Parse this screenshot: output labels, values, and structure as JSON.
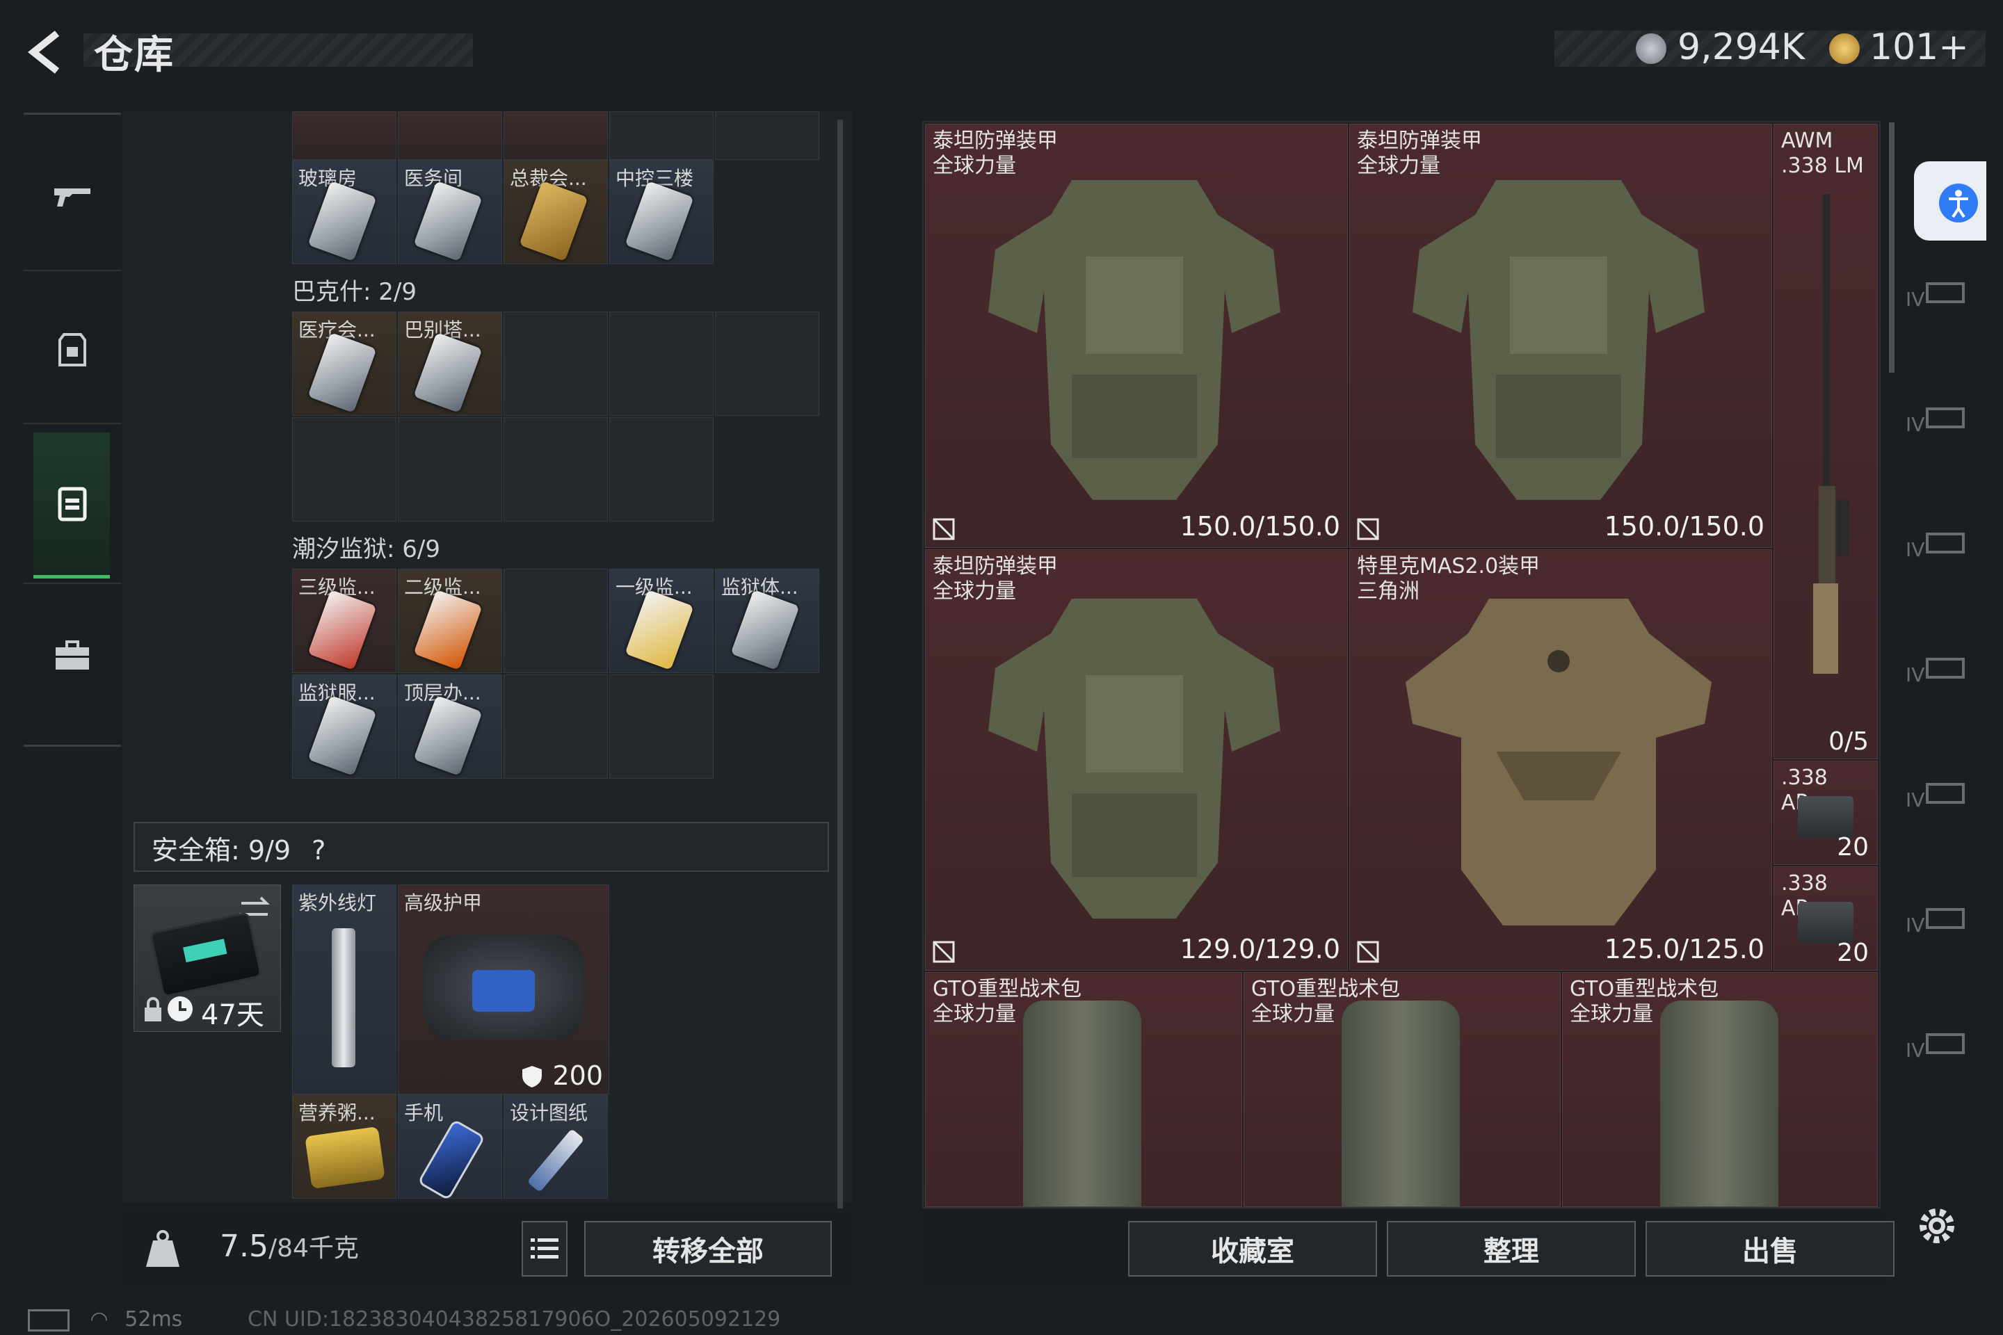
{
  "header": {
    "title": "仓库",
    "currency_coin": "9,294K",
    "currency_premium": "101+"
  },
  "colors": {
    "accent_green": "#3fbf6a",
    "cell_red": "#4b2a2e"
  },
  "stash": {
    "top_row": [
      "玻璃房",
      "医务间",
      "总裁会...",
      "中控三楼"
    ],
    "bakhsh_title": "巴克什: 2/9",
    "bakhsh_items": [
      "医疗会...",
      "巴别塔..."
    ],
    "tide_title": "潮汐监狱: 6/9",
    "tide_items": [
      "三级监...",
      "二级监...",
      "一级监...",
      "监狱体...",
      "监狱服...",
      "顶层办..."
    ]
  },
  "safebox": {
    "label": "安全箱:  9/9",
    "help": "?",
    "days": "47天",
    "items": {
      "uv_lamp": "紫外线灯",
      "guard": "高级护甲",
      "guard_value": "200",
      "nutrition": "营养粥...",
      "phone": "手机",
      "blueprint": "设计图纸"
    }
  },
  "footer_left": {
    "weight": "7.5",
    "weight_unit": "/84千克",
    "transfer_all": "转移全部"
  },
  "inventory": {
    "items": [
      {
        "name": "泰坦防弹装甲\n全球力量",
        "durability": "150.0/150.0"
      },
      {
        "name": "泰坦防弹装甲\n全球力量",
        "durability": "150.0/150.0"
      },
      {
        "name": "泰坦防弹装甲\n全球力量",
        "durability": "129.0/129.0"
      },
      {
        "name": "特里克MAS2.0装甲\n三角洲",
        "durability": "125.0/125.0"
      }
    ],
    "rifle": {
      "name": "AWM\n.338 LM",
      "ammo": "0/5"
    },
    "ammo": [
      {
        "name": ".338\nAP",
        "count": "20"
      },
      {
        "name": ".338\nAP",
        "count": "20"
      }
    ],
    "backpacks": [
      "GTO重型战术包\n全球力量",
      "GTO重型战术包\n全球力量",
      "GTO重型战术包\n全球力量"
    ]
  },
  "footer_right": {
    "collection": "收藏室",
    "sort": "整理",
    "sell": "出售"
  },
  "filter_label": "IV",
  "status": {
    "ping": "52ms",
    "uid": "CN UID:18238304043825817906O_202605092129"
  }
}
